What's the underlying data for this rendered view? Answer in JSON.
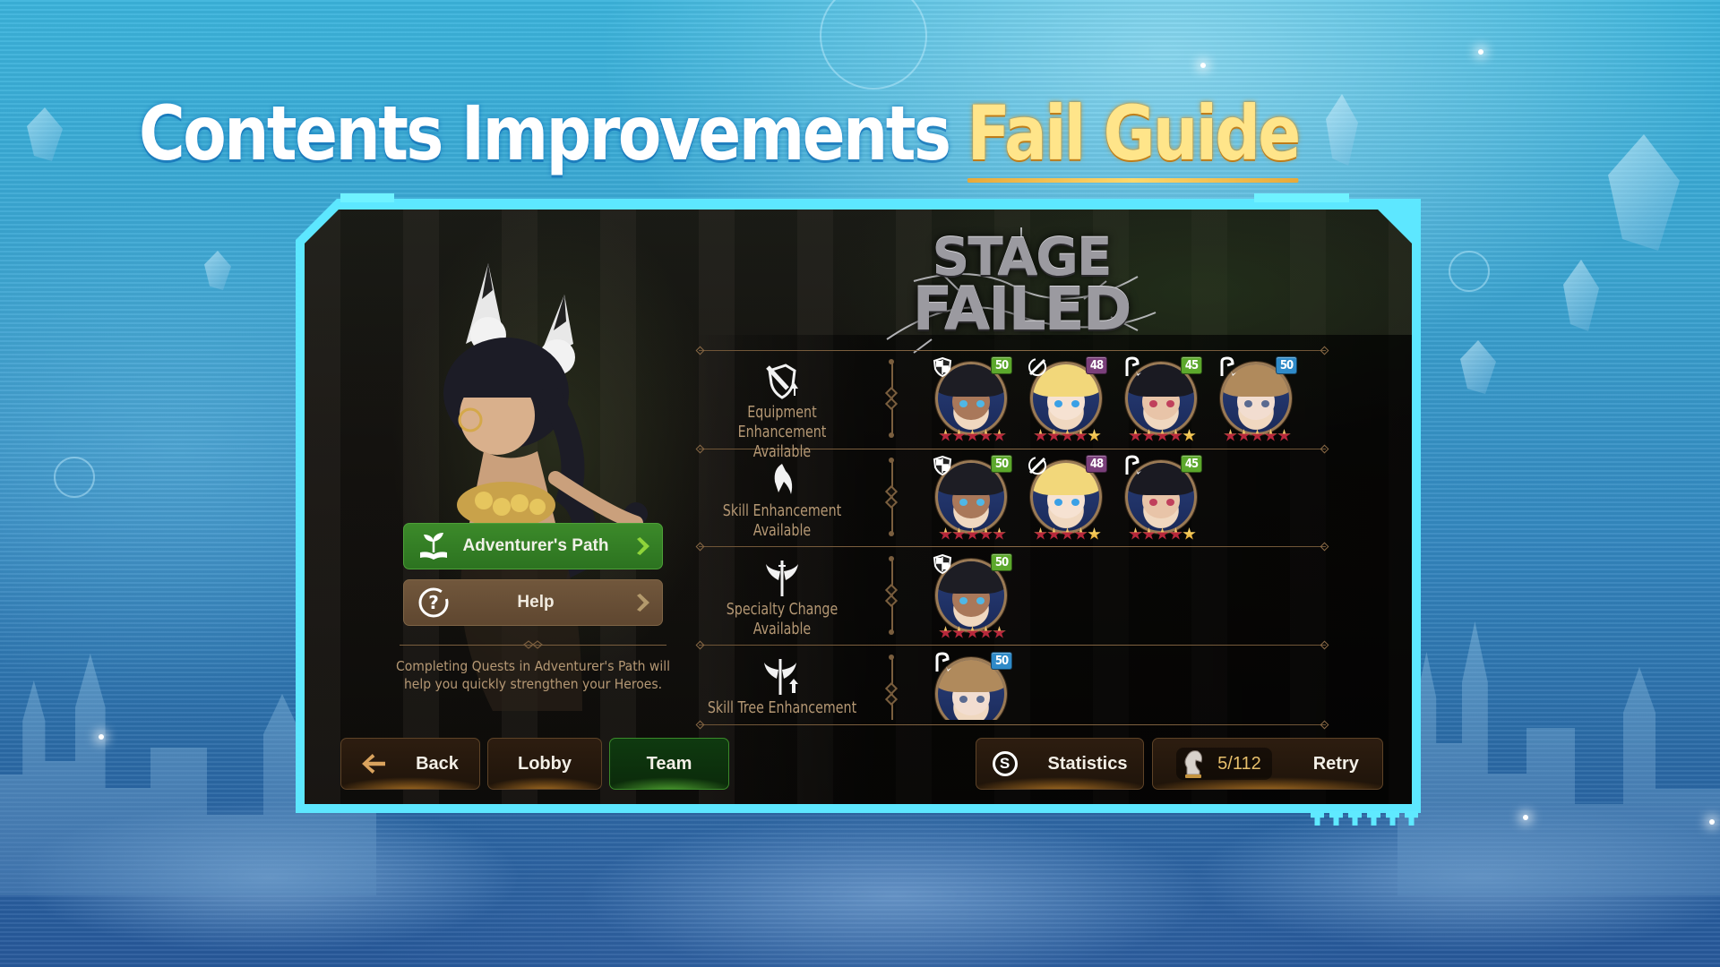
{
  "headline": {
    "prefix": "Contents Improvements",
    "highlight": "Fail Guide"
  },
  "colors": {
    "highlight": "#ffe58a",
    "frame": "#5de7ff",
    "label": "#b59874",
    "path_button": "#3c8a2a",
    "help_button": "#71573c",
    "team_button": "#0f3a10",
    "stamina": "#e7bf6c",
    "level_green": "#5ca82c",
    "level_purple": "#7a3f7a",
    "level_blue": "#2f8ac8"
  },
  "stage": {
    "title_line1": "STAGE",
    "title_line2": "FAILED"
  },
  "categories": [
    {
      "icon": "equipment-enhance-icon",
      "label": "Equipment Enhancement Available",
      "heroes": [
        {
          "role": "knight-shield-icon",
          "level": "50",
          "level_color": "green",
          "stars_red": 5,
          "stars_gold": 0,
          "look": "dark"
        },
        {
          "role": "warrior-sword-icon",
          "level": "48",
          "level_color": "purple",
          "stars_red": 4,
          "stars_gold": 1,
          "look": "blonde"
        },
        {
          "role": "wizard-staff-icon",
          "level": "45",
          "level_color": "green",
          "stars_red": 4,
          "stars_gold": 1,
          "look": "black"
        },
        {
          "role": "wizard-staff-icon",
          "level": "50",
          "level_color": "blue",
          "stars_red": 5,
          "stars_gold": 0,
          "look": "brown"
        }
      ]
    },
    {
      "icon": "skill-enhance-icon",
      "label": "Skill Enhancement Available",
      "heroes": [
        {
          "role": "knight-shield-icon",
          "level": "50",
          "level_color": "green",
          "stars_red": 5,
          "stars_gold": 0,
          "look": "dark"
        },
        {
          "role": "warrior-sword-icon",
          "level": "48",
          "level_color": "purple",
          "stars_red": 4,
          "stars_gold": 1,
          "look": "blonde"
        },
        {
          "role": "wizard-staff-icon",
          "level": "45",
          "level_color": "green",
          "stars_red": 4,
          "stars_gold": 1,
          "look": "black"
        }
      ]
    },
    {
      "icon": "specialty-change-icon",
      "label": "Specialty Change Available",
      "heroes": [
        {
          "role": "knight-shield-icon",
          "level": "50",
          "level_color": "green",
          "stars_red": 5,
          "stars_gold": 0,
          "look": "dark"
        }
      ]
    },
    {
      "icon": "skill-tree-enhance-icon",
      "label": "Skill Tree Enhancement Available",
      "heroes": [
        {
          "role": "wizard-staff-icon",
          "level": "50",
          "level_color": "blue",
          "stars_red": 5,
          "stars_gold": 0,
          "look": "brown"
        }
      ]
    }
  ],
  "side_actions": {
    "path_label": "Adventurer's Path",
    "help_label": "Help",
    "tip": "Completing Quests in Adventurer's Path will help you quickly strengthen your Heroes."
  },
  "bottom_bar": {
    "back_label": "Back",
    "lobby_label": "Lobby",
    "team_label": "Team",
    "statistics_label": "Statistics",
    "statistics_icon_glyph": "S",
    "stamina_value": "5/112",
    "retry_label": "Retry"
  }
}
